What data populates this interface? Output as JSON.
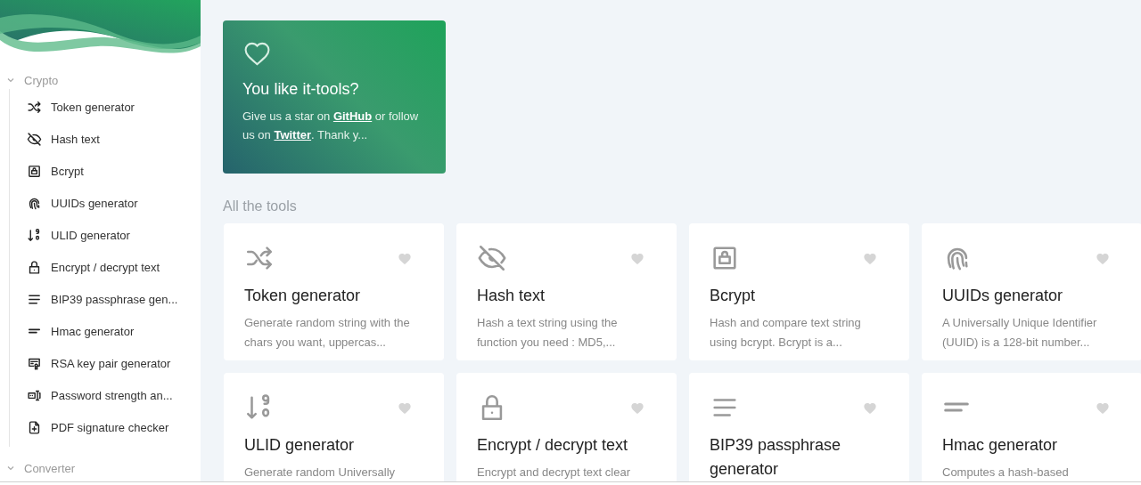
{
  "sidebar": {
    "groups": [
      {
        "label": "Crypto",
        "expanded": true,
        "items": [
          "Token generator",
          "Hash text",
          "Bcrypt",
          "UUIDs generator",
          "ULID generator",
          "Encrypt / decrypt text",
          "BIP39 passphrase gen...",
          "Hmac generator",
          "RSA key pair generator",
          "Password strength an...",
          "PDF signature checker"
        ]
      },
      {
        "label": "Converter",
        "expanded": true
      }
    ]
  },
  "hero": {
    "title": "You like it-tools?",
    "text_parts": [
      {
        "text": "Give us a star on ",
        "link": false
      },
      {
        "text": "GitHub",
        "link": true
      },
      {
        "text": " or follow us on ",
        "link": false
      },
      {
        "text": "Twitter",
        "link": true
      },
      {
        "text": ". Thank y...",
        "link": false
      }
    ]
  },
  "section_title": "All the tools",
  "cards": [
    {
      "title": "Token generator",
      "description": "Generate random string with the chars you want, uppercas...",
      "favorite": false
    },
    {
      "title": "Hash text",
      "description": "Hash a text string using the function you need : MD5,...",
      "favorite": false
    },
    {
      "title": "Bcrypt",
      "description": "Hash and compare text string using bcrypt. Bcrypt is a...",
      "favorite": false
    },
    {
      "title": "UUIDs generator",
      "description": "A Universally Unique Identifier (UUID) is a 128-bit number...",
      "favorite": false
    },
    {
      "title": "ULID generator",
      "description": "Generate random Universally",
      "favorite": false
    },
    {
      "title": "Encrypt / decrypt text",
      "description": "Encrypt and decrypt text clear",
      "favorite": false
    },
    {
      "title": "BIP39 passphrase generator",
      "favorite": false
    },
    {
      "title": "Hmac generator",
      "description": "Computes a hash-based",
      "favorite": false
    }
  ]
}
